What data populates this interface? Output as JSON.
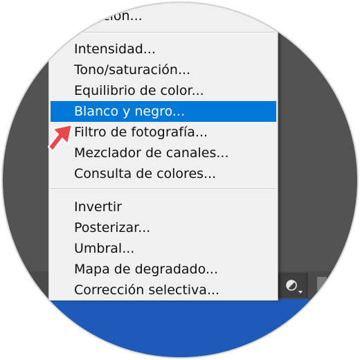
{
  "menu": {
    "partial_top_item": "…ección...",
    "group1": [
      {
        "label": "Intensidad..."
      },
      {
        "label": "Tono/saturación..."
      },
      {
        "label": "Equilibrio de color..."
      },
      {
        "label": "Blanco y negro...",
        "selected": true
      },
      {
        "label": "Filtro de fotografía..."
      },
      {
        "label": "Mezclador de canales..."
      },
      {
        "label": "Consulta de colores..."
      }
    ],
    "group2": [
      {
        "label": "Invertir"
      },
      {
        "label": "Posterizar..."
      },
      {
        "label": "Umbral..."
      },
      {
        "label": "Mapa de degradado..."
      },
      {
        "label": "Corrección selectiva..."
      }
    ]
  },
  "colors": {
    "selection": "#0078d7",
    "menu_bg": "#f0f0f0",
    "workspace": "#535353",
    "accent_blue": "#1e5bb8",
    "annotation_arrow": "#e8474b"
  },
  "icons": {
    "annotation": "pointer-arrow-icon",
    "adjustment_button": "half-circle-adjustment-icon"
  }
}
